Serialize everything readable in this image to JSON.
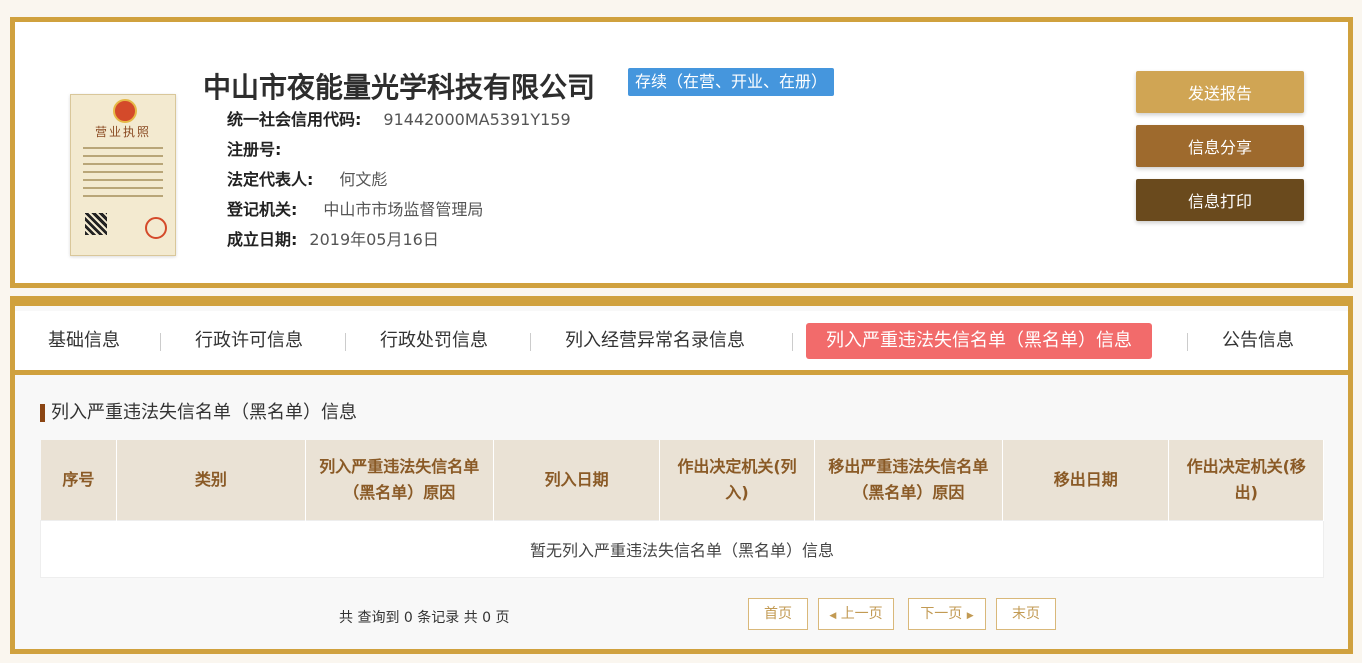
{
  "company": {
    "name": "中山市夜能量光学科技有限公司",
    "status": "存续（在营、开业、在册）",
    "license_image": {
      "title": "营业执照",
      "emblem": "national-emblem-icon",
      "qr": "qr-code-icon",
      "seal": "official-seal-icon"
    },
    "fields": [
      {
        "label": "统一社会信用代码:",
        "value": "91442000MA5391Y159"
      },
      {
        "label": "注册号:",
        "value": ""
      },
      {
        "label": "法定代表人:",
        "value": "何文彪"
      },
      {
        "label": "登记机关:",
        "value": "中山市市场监督管理局"
      },
      {
        "label": "成立日期:",
        "value": "2019年05月16日"
      }
    ]
  },
  "actions": {
    "report": "发送报告",
    "share": "信息分享",
    "print": "信息打印"
  },
  "tabs": [
    {
      "label": "基础信息"
    },
    {
      "label": "行政许可信息"
    },
    {
      "label": "行政处罚信息"
    },
    {
      "label": "列入经营异常名录信息"
    },
    {
      "label": "列入严重违法失信名单（黑名单）信息",
      "active": true
    },
    {
      "label": "公告信息"
    }
  ],
  "section": {
    "title": "列入严重违法失信名单（黑名单）信息",
    "columns": [
      "序号",
      "类别",
      "列入严重违法失信名单（黑名单）原因",
      "列入日期",
      "作出决定机关(列入)",
      "移出严重违法失信名单（黑名单）原因",
      "移出日期",
      "作出决定机关(移出)"
    ],
    "empty_message": "暂无列入严重违法失信名单（黑名单）信息"
  },
  "pagination": {
    "summary": "共 查询到 0 条记录 共 0 页",
    "first": "首页",
    "prev": "上一页",
    "next": "下一页",
    "last": "末页"
  },
  "colors": {
    "frame": "#d0a13e",
    "status_badge": "#4596dd",
    "active_tab": "#f26b6b",
    "btn_report": "#d0a554",
    "btn_share": "#9e6a2d",
    "btn_print": "#6a4a1d"
  }
}
